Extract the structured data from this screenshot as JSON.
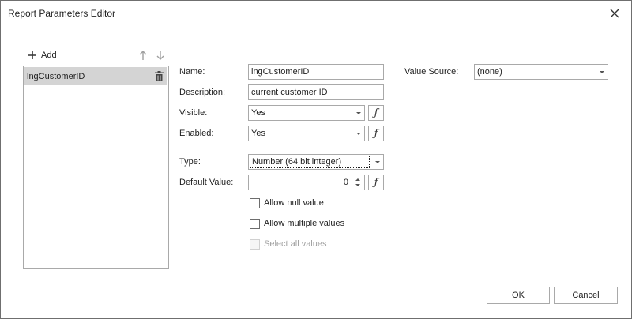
{
  "window": {
    "title": "Report Parameters Editor"
  },
  "toolbar": {
    "add_label": "Add"
  },
  "parameters": [
    {
      "name": "lngCustomerID"
    }
  ],
  "form": {
    "name_label": "Name:",
    "name_value": "lngCustomerID",
    "description_label": "Description:",
    "description_value": "current customer ID",
    "visible_label": "Visible:",
    "visible_value": "Yes",
    "enabled_label": "Enabled:",
    "enabled_value": "Yes",
    "type_label": "Type:",
    "type_value": "Number (64 bit integer)",
    "default_label": "Default Value:",
    "default_value": "0",
    "value_source_label": "Value Source:",
    "value_source_value": "(none)",
    "fx_glyph": "ƒ",
    "allow_null_label": "Allow null value",
    "allow_multiple_label": "Allow multiple values",
    "select_all_label": "Select all values"
  },
  "buttons": {
    "ok": "OK",
    "cancel": "Cancel"
  },
  "icons": {
    "close": "close-icon",
    "add": "plus-icon",
    "up": "arrow-up-icon",
    "down": "arrow-down-icon",
    "delete": "trash-icon"
  }
}
